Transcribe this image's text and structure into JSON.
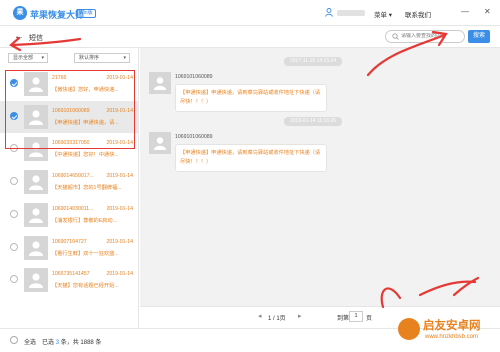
{
  "app": {
    "logo_text": "果",
    "title": "苹果恢复大师",
    "badge": "Win版"
  },
  "topbar": {
    "menu_label": "菜单 ▾",
    "contact_label": "联系我们",
    "minimize": "—",
    "close": "✕"
  },
  "header": {
    "title": "短信",
    "search_placeholder": "请输入要查找的内容",
    "search_button": "搜索"
  },
  "filters": {
    "show": "显示全部",
    "sort": "默认排序"
  },
  "conversations": [
    {
      "number": "21766",
      "date": "2019-01-14",
      "preview": "【微快递】您好，申通快递...",
      "selected": true,
      "highlight": false
    },
    {
      "number": "1069101060089",
      "date": "2019-01-14",
      "preview": "【申通快递】申通快递，请...",
      "selected": true,
      "highlight": true
    },
    {
      "number": "1069033317050",
      "date": "2019-01-14",
      "preview": "【中通快递】您好！中通快...",
      "selected": false,
      "highlight": false
    },
    {
      "number": "1069014650017...",
      "date": "2019-01-14",
      "preview": "【天猫超市】您的1号翻牌福...",
      "selected": false,
      "highlight": false
    },
    {
      "number": "1069014030011...",
      "date": "2019-01-14",
      "preview": "【浦发银行】尊敬的E启动...",
      "selected": false,
      "highlight": false
    },
    {
      "number": "106907104727",
      "date": "2019-01-14",
      "preview": "【看行生鲜】双十一狂欢盛...",
      "selected": false,
      "highlight": false
    },
    {
      "number": "1065735141457",
      "date": "2019-01-14",
      "preview": "【天猫】您有话题已经开始...",
      "selected": false,
      "highlight": false
    }
  ],
  "messages": [
    {
      "time": "2017-11-18 14:15:24",
      "from": "1069101060089",
      "text": "【申通快递】申通快递，请到菜鸟驿站或收件地址下快递（请尽快！！！）"
    },
    {
      "time": "2019-01-14 11:16:26",
      "from": "1069101060089",
      "text": "【申通快递】申通快递，请到菜鸟驿站或收件地址下快递（请尽快！！！）"
    }
  ],
  "pager": {
    "prev": "◂",
    "info": "1 / 1页",
    "next": "▸",
    "goto_label": "到第",
    "page_value": "1",
    "unit": "页"
  },
  "footer": {
    "select_all": "全选",
    "selected_prefix": "已选",
    "selected_count": "3",
    "selected_mid": "条，共",
    "total_count": "1888",
    "total_suffix": "条"
  },
  "watermark": {
    "title": "启友安卓网",
    "url": "www.hnzkhbsb.com"
  },
  "colors": {
    "accent": "#3a8ee6",
    "orange": "#e8821e",
    "annotation_red": "#e53935"
  }
}
